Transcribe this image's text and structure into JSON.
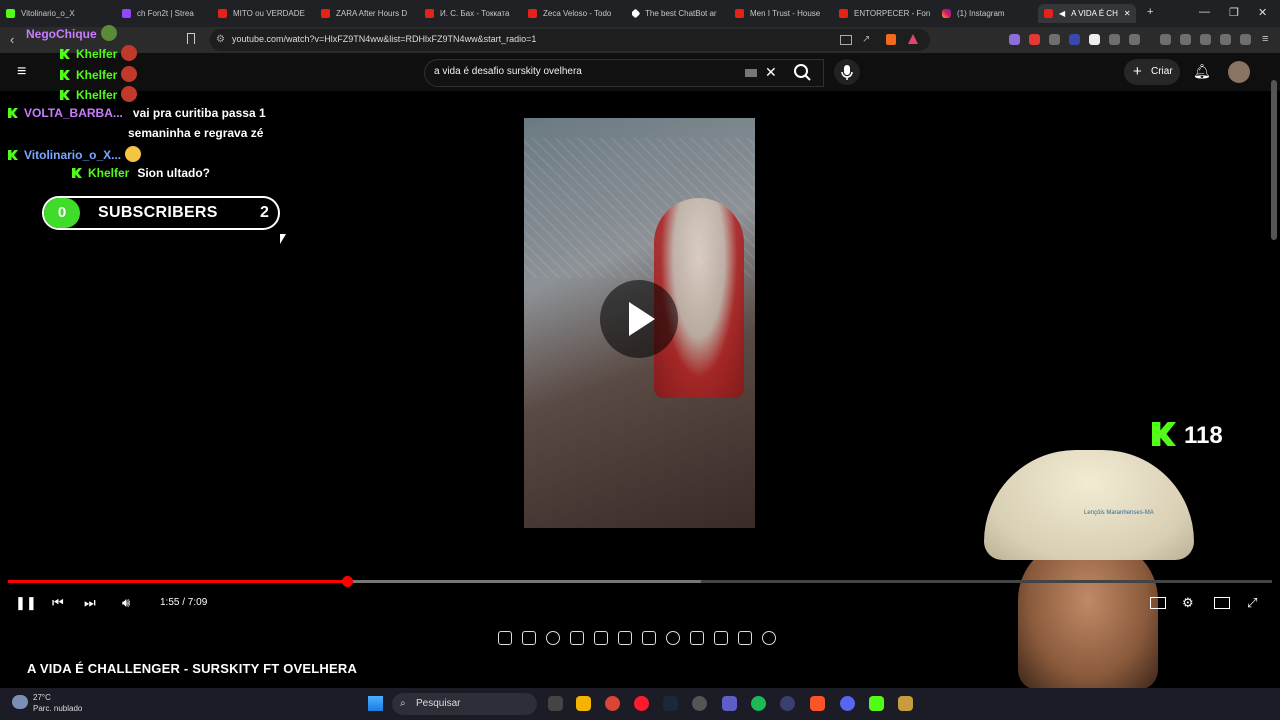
{
  "browser": {
    "tabs": [
      {
        "label": "Vitolinario_o_X"
      },
      {
        "label": "ch Fon2t | Strea"
      },
      {
        "label": "MITO ou VERDADE"
      },
      {
        "label": "ZARA After Hours D"
      },
      {
        "label": "И. С. Бах - Токката"
      },
      {
        "label": "Zeca Veloso - Todo"
      },
      {
        "label": "The best ChatBot ar"
      },
      {
        "label": "Men I Trust - House"
      },
      {
        "label": "ENTORPECER - Fon"
      },
      {
        "label": "(1) Instagram"
      },
      {
        "label": "A VIDA É CH"
      }
    ],
    "new_tab": "+",
    "url": "youtube.com/watch?v=HlxFZ9TN4ww&list=RDHlxFZ9TN4ww&start_radio=1"
  },
  "youtube": {
    "search_value": "a vida é desafio surskity ovelhera",
    "create_label": "Criar",
    "video_title": "A VIDA É CHALLENGER - SURSKITY FT OVELHERA",
    "time": "1:55 / 7:09",
    "progress_fraction": 0.268,
    "buffered_fraction": 0.548
  },
  "chat": {
    "messages": [
      {
        "user": "NegoChique",
        "color": "#c77dff",
        "text": ""
      },
      {
        "user": "Khelfer",
        "color": "#53fc18",
        "text": ""
      },
      {
        "user": "Khelfer",
        "color": "#53fc18",
        "text": ""
      },
      {
        "user": "Khelfer",
        "color": "#53fc18",
        "text": ""
      },
      {
        "user": "VOLTA_BARBA...",
        "color": "#c77dff",
        "text": "vai pra curitiba passa 1"
      },
      {
        "user": "",
        "color": "#ffffff",
        "text": "semaninha e regrava zé"
      },
      {
        "user": "Vitolinario_o_X...",
        "color": "#7aa7ff",
        "text": ""
      },
      {
        "user": "Khelfer",
        "color": "#53fc18",
        "text": "Sion ultado?"
      }
    ]
  },
  "overlay": {
    "subs_left": "0",
    "subs_label": "SUBSCRIBERS",
    "subs_right": "2",
    "kick_count": "118",
    "hat_text": "Lençóis Maranhenses-MA"
  },
  "taskbar": {
    "temperature": "27°C",
    "weather": "Parc. nublado",
    "search_placeholder": "Pesquisar"
  }
}
